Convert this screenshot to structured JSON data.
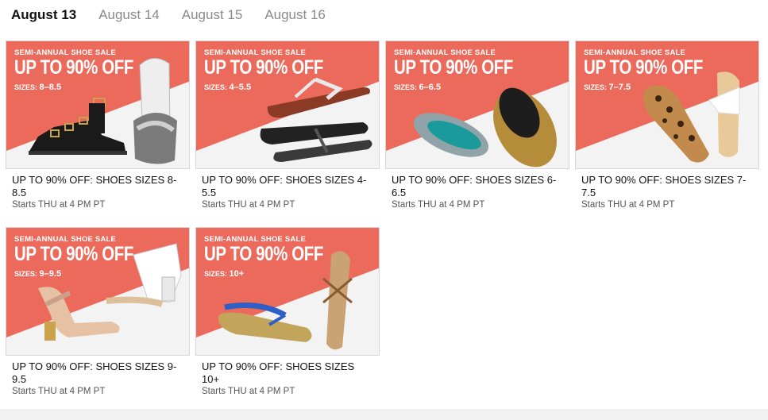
{
  "tabs": [
    {
      "label": "August 13",
      "active": true
    },
    {
      "label": "August 14",
      "active": false
    },
    {
      "label": "August 15",
      "active": false
    },
    {
      "label": "August 16",
      "active": false
    }
  ],
  "banner": {
    "line1": "SEMI-ANNUAL SHOE SALE",
    "line2": "UP TO 90% OFF",
    "sizes_prefix": "SIZES:"
  },
  "colors": {
    "banner_coral": "#ec6a5c",
    "tab_active": "#111111",
    "tab_inactive": "#8a8a8a"
  },
  "cards": [
    {
      "size": "8–8.5",
      "title": "UP TO 90% OFF: SHOES SIZES 8-8.5",
      "title_l1": "UP TO 90% OFF: SHOES SIZES 8-",
      "title_l2": "8.5",
      "subtitle": "Starts THU at 4 PM PT"
    },
    {
      "size": "4–5.5",
      "title": "UP TO 90% OFF: SHOES SIZES 4-5.5",
      "title_l1": "UP TO 90% OFF: SHOES SIZES 4-",
      "title_l2": "5.5",
      "subtitle": "Starts THU at 4 PM PT"
    },
    {
      "size": "6–6.5",
      "title": "UP TO 90% OFF: SHOES SIZES 6-6.5",
      "title_l1": "UP TO 90% OFF: SHOES SIZES 6-",
      "title_l2": "6.5",
      "subtitle": "Starts THU at 4 PM PT"
    },
    {
      "size": "7–7.5",
      "title": "UP TO 90% OFF: SHOES SIZES 7-7.5",
      "title_l1": "UP TO 90% OFF: SHOES SIZES 7-",
      "title_l2": "7.5",
      "subtitle": "Starts THU at 4 PM PT"
    },
    {
      "size": "9–9.5",
      "title": "UP TO 90% OFF: SHOES SIZES 9-9.5",
      "title_l1": "UP TO 90% OFF: SHOES SIZES 9-",
      "title_l2": "9.5",
      "subtitle": "Starts THU at 4 PM PT"
    },
    {
      "size": "10+",
      "title": "UP TO 90% OFF: SHOES SIZES 10+",
      "title_l1": "UP TO 90% OFF: SHOES SIZES",
      "title_l2": "10+",
      "subtitle": "Starts THU at 4 PM PT"
    }
  ]
}
